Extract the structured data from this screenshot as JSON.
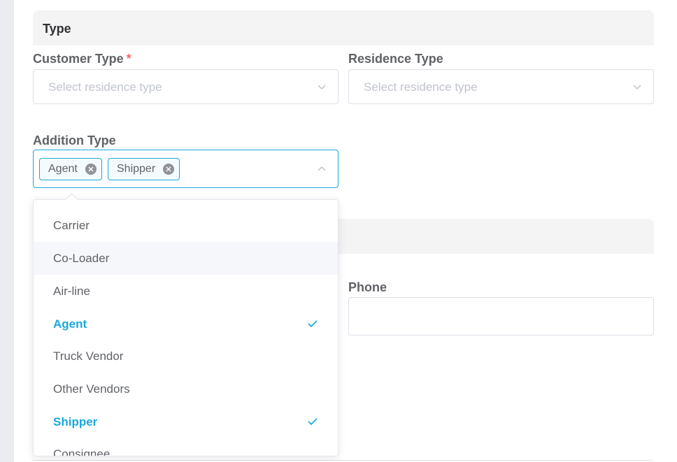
{
  "section_type": {
    "title": "Type"
  },
  "customer_type": {
    "label": "Customer Type",
    "required_mark": "*",
    "placeholder": "Select residence type"
  },
  "residence_type": {
    "label": "Residence Type",
    "placeholder": "Select residence type"
  },
  "addition_type": {
    "label": "Addition Type",
    "tags": [
      "Agent",
      "Shipper"
    ]
  },
  "phone": {
    "label": "Phone",
    "value": ""
  },
  "dropdown": {
    "options": [
      {
        "label": "Carrier",
        "selected": false,
        "hover": false
      },
      {
        "label": "Co-Loader",
        "selected": false,
        "hover": true
      },
      {
        "label": "Air-line",
        "selected": false,
        "hover": false
      },
      {
        "label": "Agent",
        "selected": true,
        "hover": false
      },
      {
        "label": "Truck Vendor",
        "selected": false,
        "hover": false
      },
      {
        "label": "Other Vendors",
        "selected": false,
        "hover": false
      },
      {
        "label": "Shipper",
        "selected": true,
        "hover": false
      },
      {
        "label": "Consignee",
        "selected": false,
        "hover": false
      }
    ]
  },
  "colors": {
    "accent": "#1aa8dc",
    "required": "#f56c6c",
    "placeholder": "#c0c4cc",
    "section_bg": "#f4f4f5"
  },
  "icons": {
    "select_chevron": "chevron-down-icon",
    "multi_chevron": "chevron-up-icon",
    "tag_remove": "close-circle-icon",
    "option_check": "check-icon"
  }
}
